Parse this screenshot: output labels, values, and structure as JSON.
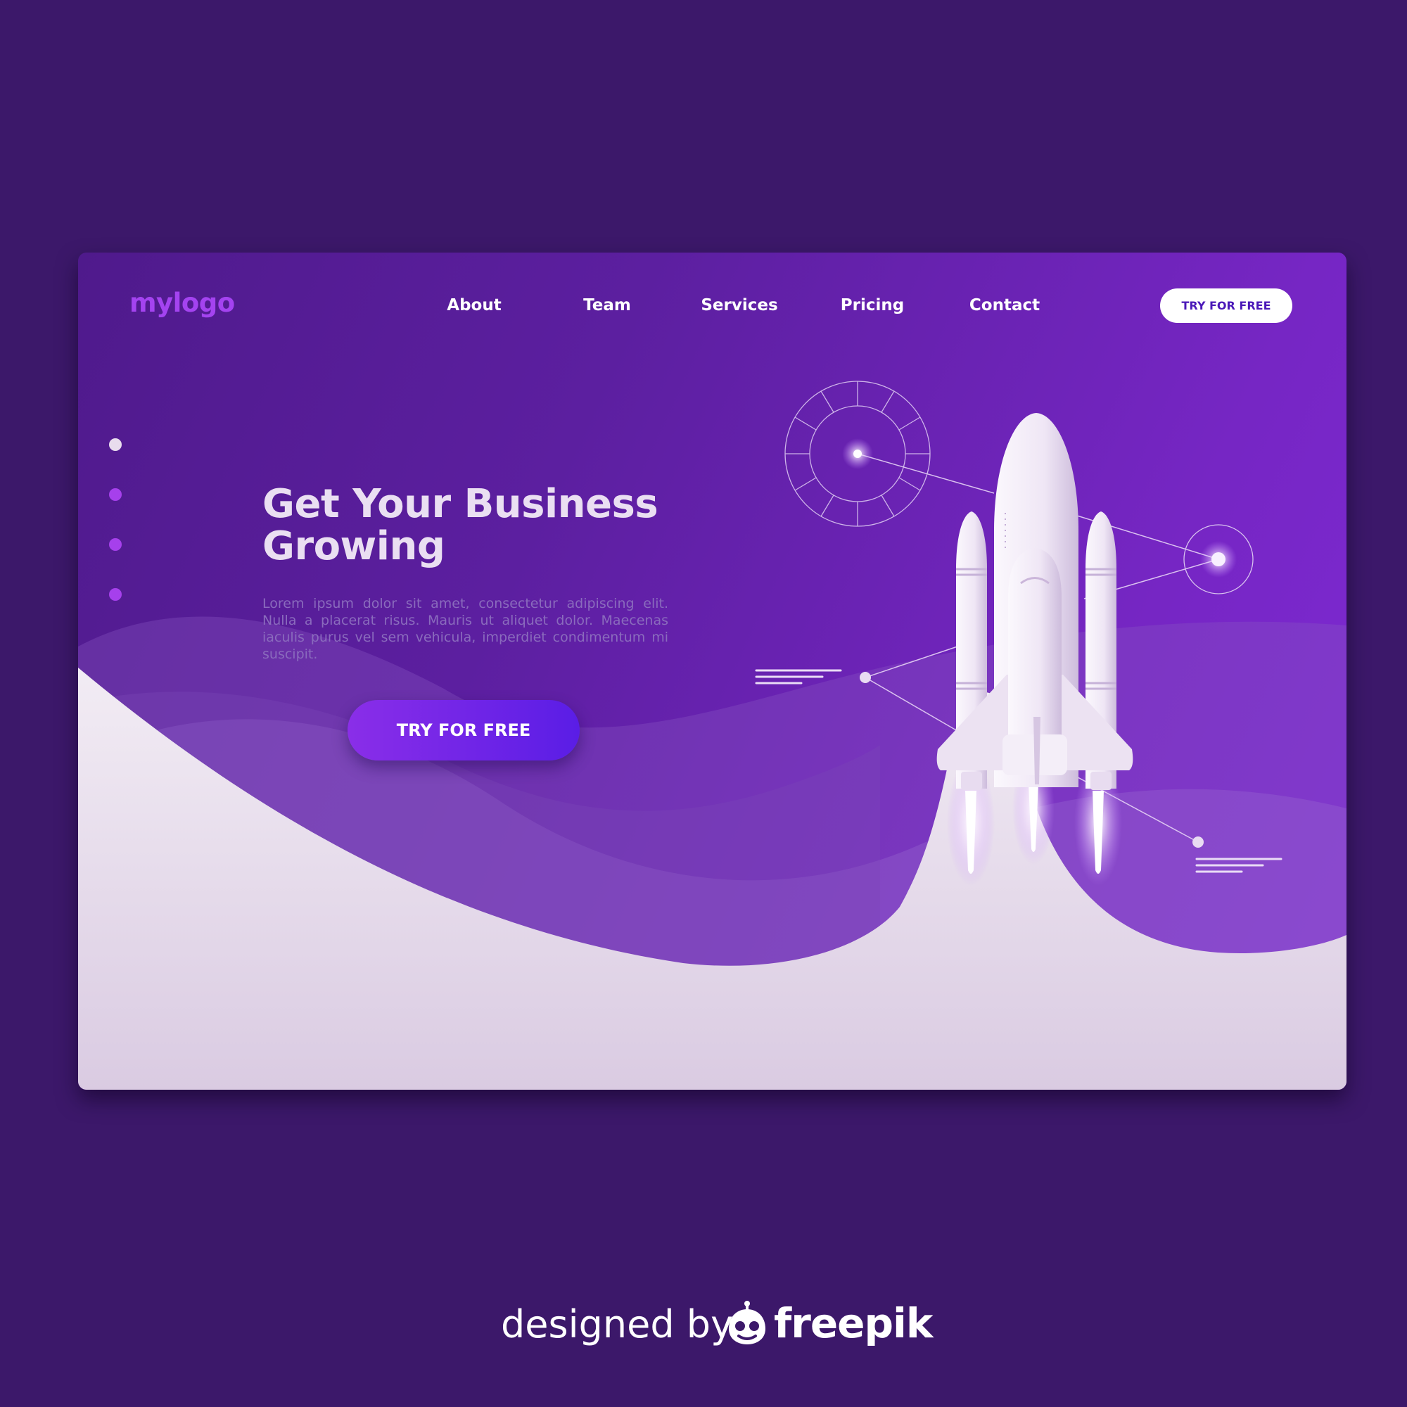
{
  "brand": {
    "logo": "mylogo"
  },
  "nav": {
    "items": [
      "About",
      "Team",
      "Services",
      "Pricing",
      "Contact"
    ],
    "cta_label": "TRY FOR FREE"
  },
  "hero": {
    "title": "Get Your Business Growing",
    "body": "Lorem ipsum dolor sit amet, consectetur adipiscing elit. Nulla a placerat risus. Mauris ut aliquet dolor. Maecenas iaculis purus vel sem vehicula, imperdiet condimentum mi suscipit.",
    "cta_label": "TRY FOR FREE"
  },
  "slider": {
    "dot_count": 4,
    "active_index": 0
  },
  "illustration": {
    "subject": "rocket-icon"
  },
  "credit": {
    "text": "designed by",
    "brand": "freepik"
  },
  "colors": {
    "page_bg": "#3c186a",
    "accent": "#a443f0",
    "cta_gradient_start": "#8a2ee8",
    "cta_gradient_end": "#5a1de6",
    "hill_light": "#e6dbec"
  }
}
